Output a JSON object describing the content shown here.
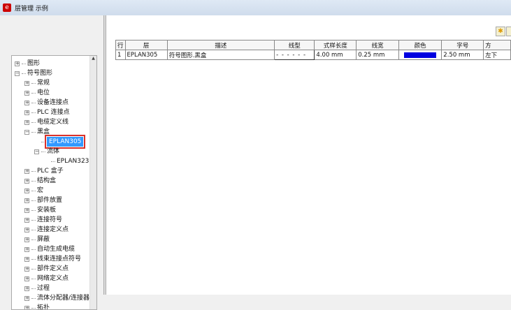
{
  "window": {
    "title": "层管理 示例",
    "icon": "eplan-logo-icon"
  },
  "tree": [
    {
      "label": "图形",
      "level": 0,
      "expander": "+"
    },
    {
      "label": "符号图形",
      "level": 0,
      "expander": "-"
    },
    {
      "label": "常规",
      "level": 1,
      "expander": "+"
    },
    {
      "label": "电位",
      "level": 1,
      "expander": "+"
    },
    {
      "label": "设备连接点",
      "level": 1,
      "expander": "+"
    },
    {
      "label": "PLC 连接点",
      "level": 1,
      "expander": "+"
    },
    {
      "label": "电缆定义线",
      "level": 1,
      "expander": "+"
    },
    {
      "label": "黑盒",
      "level": 1,
      "expander": "-"
    },
    {
      "label": "EPLAN305",
      "level": 2,
      "expander": "",
      "selected": true
    },
    {
      "label": "流体",
      "level": 2,
      "expander": "-"
    },
    {
      "label": "EPLAN323",
      "level": 3,
      "expander": ""
    },
    {
      "label": "PLC 盒子",
      "level": 1,
      "expander": "+"
    },
    {
      "label": "结构盒",
      "level": 1,
      "expander": "+"
    },
    {
      "label": "宏",
      "level": 1,
      "expander": "+"
    },
    {
      "label": "部件放置",
      "level": 1,
      "expander": "+"
    },
    {
      "label": "安装板",
      "level": 1,
      "expander": "+"
    },
    {
      "label": "连接符号",
      "level": 1,
      "expander": "+"
    },
    {
      "label": "连接定义点",
      "level": 1,
      "expander": "+"
    },
    {
      "label": "屏蔽",
      "level": 1,
      "expander": "+"
    },
    {
      "label": "自动生成电缆",
      "level": 1,
      "expander": "+"
    },
    {
      "label": "线束连接点符号",
      "level": 1,
      "expander": "+"
    },
    {
      "label": "部件定义点",
      "level": 1,
      "expander": "+"
    },
    {
      "label": "网络定义点",
      "level": 1,
      "expander": "+"
    },
    {
      "label": "过程",
      "level": 1,
      "expander": "+"
    },
    {
      "label": "流体分配器/连接器",
      "level": 1,
      "expander": "+"
    },
    {
      "label": "拓扑",
      "level": 1,
      "expander": "+"
    }
  ],
  "table": {
    "headers": [
      "行",
      "层",
      "描述",
      "线型",
      "式样长度",
      "线宽",
      "颜色",
      "字号",
      "方"
    ],
    "rows": [
      {
        "row": "1",
        "layer": "EPLAN305",
        "desc": "符号图形.黑盒",
        "linetype": "- - - - - -",
        "pattern_length": "4.00 mm",
        "line_width": "0.25 mm",
        "color": "#0000e0",
        "font_size": "2.50 mm",
        "direction": "左下"
      }
    ]
  }
}
